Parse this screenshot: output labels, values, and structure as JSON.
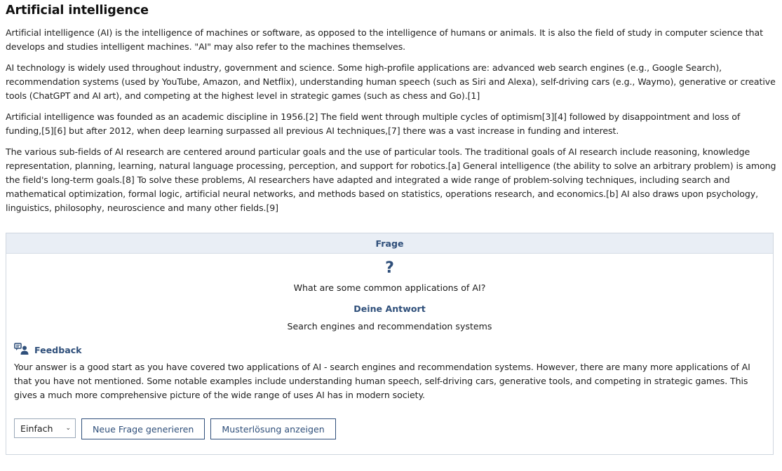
{
  "article": {
    "title": "Artificial intelligence",
    "paragraphs": [
      "Artificial intelligence (AI) is the intelligence of machines or software, as opposed to the intelligence of humans or animals. It is also the field of study in computer science that develops and studies intelligent machines. \"AI\" may also refer to the machines themselves.",
      "AI technology is widely used throughout industry, government and science. Some high-profile applications are: advanced web search engines (e.g., Google Search), recommendation systems (used by YouTube, Amazon, and Netflix), understanding human speech (such as Siri and Alexa), self-driving cars (e.g., Waymo), generative or creative tools (ChatGPT and AI art), and competing at the highest level in strategic games (such as chess and Go).[1]",
      "Artificial intelligence was founded as an academic discipline in 1956.[2] The field went through multiple cycles of optimism[3][4] followed by disappointment and loss of funding,[5][6] but after 2012, when deep learning surpassed all previous AI techniques,[7] there was a vast increase in funding and interest.",
      "The various sub-fields of AI research are centered around particular goals and the use of particular tools. The traditional goals of AI research include reasoning, knowledge representation, planning, learning, natural language processing, perception, and support for robotics.[a] General intelligence (the ability to solve an arbitrary problem) is among the field's long-term goals.[8] To solve these problems, AI researchers have adapted and integrated a wide range of problem-solving techniques, including search and mathematical optimization, formal logic, artificial neural networks, and methods based on statistics, operations research, and economics.[b] AI also draws upon psychology, linguistics, philosophy, neuroscience and many other fields.[9]"
    ]
  },
  "quiz": {
    "header": "Frage",
    "question_icon": "?",
    "question": "What are some common applications of AI?",
    "answer_label": "Deine Antwort",
    "answer": "Search engines and recommendation systems",
    "feedback_label": "Feedback",
    "feedback_icon": "feedback-icon",
    "feedback_text": "Your answer is a good start as you have covered two applications of AI - search engines and recommendation systems. However, there are many more applications of AI that you have not mentioned. Some notable examples include understanding human speech, self-driving cars, generative tools, and competing in strategic games. This gives a much more comprehensive picture of the wide range of uses AI has in modern society.",
    "difficulty_selected": "Einfach",
    "new_question_button": "Neue Frage generieren",
    "solution_button": "Musterlösung anzeigen",
    "accent_color": "#2f4f7a"
  }
}
